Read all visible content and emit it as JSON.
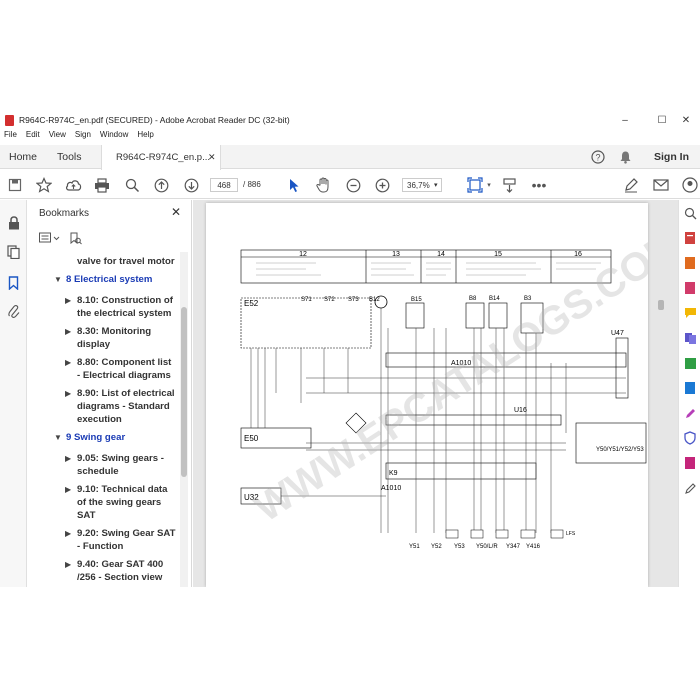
{
  "window": {
    "title": "R964C-R974C_en.pdf (SECURED) - Adobe Acrobat Reader DC (32-bit)",
    "controls": {
      "minimize": "–",
      "maximize": "☐",
      "close": "✕"
    }
  },
  "menu": [
    "File",
    "Edit",
    "View",
    "Sign",
    "Window",
    "Help"
  ],
  "tabs": {
    "home": "Home",
    "tools": "Tools",
    "doc": "R964C-R974C_en.p...",
    "doc_close": "✕",
    "sign_in": "Sign In"
  },
  "toolbar": {
    "page_current": "468",
    "page_total": "/ 886",
    "zoom": "36,7%"
  },
  "bookmarks": {
    "title": "Bookmarks",
    "close": "✕",
    "items": [
      {
        "label": "valve for travel motor",
        "level": 2
      },
      {
        "label": "8 Electrical system",
        "level": 1
      },
      {
        "label": "8.10: Construction of",
        "label2": "the electrical system",
        "level": 2
      },
      {
        "label": "8.30: Monitoring",
        "label2": "display",
        "level": 2
      },
      {
        "label": "8.80: Component list",
        "label2": "- Electrical diagrams",
        "level": 2
      },
      {
        "label": "8.90: List of electrical",
        "label2": "diagrams - Standard",
        "label3": "execution",
        "level": 2
      },
      {
        "label": "9 Swing gear",
        "level": 1
      },
      {
        "label": "9.05: Swing gears -",
        "label2": "schedule",
        "level": 2
      },
      {
        "label": "9.10: Technical data",
        "label2": "of the swing gears",
        "label3": "SAT",
        "level": 2
      },
      {
        "label": "9.20: Swing Gear SAT",
        "label2": "- Function",
        "level": 2
      },
      {
        "label": "9.40: Gear SAT 400",
        "label2": "/256 - Section view",
        "level": 2
      }
    ]
  },
  "diagram": {
    "columns": [
      "12",
      "13",
      "14",
      "15",
      "16"
    ],
    "components": [
      "E52",
      "S71",
      "S72",
      "S73",
      "B12",
      "B15",
      "B8",
      "B14",
      "B3",
      "U47",
      "A1010",
      "U16",
      "E50",
      "K9",
      "A1010",
      "U32",
      "Y51",
      "Y52",
      "Y53",
      "Y50/L/R",
      "Y347",
      "Y416",
      "Y50/Y51/Y52/Y53",
      "LFS"
    ],
    "watermark": "WWW.EPCATALOGS.COM"
  }
}
